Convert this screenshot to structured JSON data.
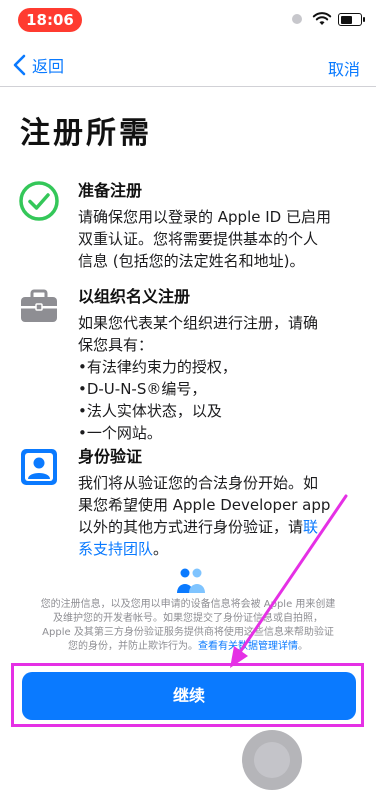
{
  "status_bar": {
    "time": "18:06"
  },
  "nav": {
    "back_label": "返回",
    "cancel_label": "取消"
  },
  "page": {
    "title": "注册所需"
  },
  "sections": [
    {
      "icon": "checkmark-circle-icon",
      "title": "准备注册",
      "lines": [
        "请确保您用以登录的 Apple ID 已启用",
        "双重认证。您将需要提供基本的个人",
        "信息 (包括您的法定姓名和地址)。"
      ]
    },
    {
      "icon": "briefcase-icon",
      "title": "以组织名义注册",
      "lines": [
        "如果您代表某个组织进行注册，请确",
        "保您具有：",
        "•有法律约束力的授权，",
        "•D-U-N-S®编号，",
        "•法人实体状态，以及",
        "•一个网站。"
      ]
    },
    {
      "icon": "person-badge-icon",
      "title": "身份验证",
      "lines": [
        "我们将从验证您的合法身份开始。如",
        "果您希望使用 Apple Developer app"
      ],
      "line3_prefix": "以外的其他方式进行身份验证，请",
      "link_part1": "联",
      "link_part2": "系支持团队",
      "end_punct": "。"
    }
  ],
  "privacy": {
    "line1": "您的注册信息，以及您用以申请的设备信息将会被 Apple 用来创建",
    "line2": "及维护您的开发者帐号。如果您提交了身份证信息或自拍照，",
    "line3": "Apple 及其第三方身份验证服务提供商将使用这些信息来帮助验证",
    "line4_prefix": "您的身份，并防止欺诈行为。",
    "line4_link": "查看有关数据管理详情",
    "line4_end": "。"
  },
  "actions": {
    "continue_label": "继续"
  },
  "colors": {
    "accent": "#0a7aff",
    "time_pill": "#ff3b30",
    "check_green": "#34c759",
    "annotation": "#e530e5"
  },
  "icons": {
    "back": "chevron-left-icon",
    "people": "people-icon",
    "wifi": "wifi-icon",
    "battery": "battery-icon"
  }
}
